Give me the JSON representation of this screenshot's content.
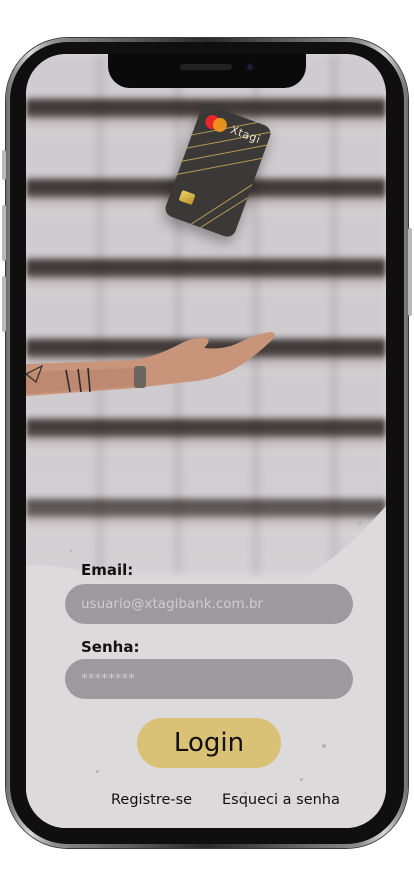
{
  "card": {
    "brand": "Xtagi",
    "network_icon": "mastercard-icon"
  },
  "form": {
    "email_label": "Email:",
    "email_placeholder": "usuario@xtagibank.com.br",
    "password_label": "Senha:",
    "password_placeholder": "********",
    "login_label": "Login"
  },
  "links": {
    "register": "Registre-se",
    "forgot": "Esqueci a senha"
  },
  "colors": {
    "login_button": "#d9c276",
    "input_background": "#9c9a9c",
    "screen_background": "#dddadc"
  }
}
